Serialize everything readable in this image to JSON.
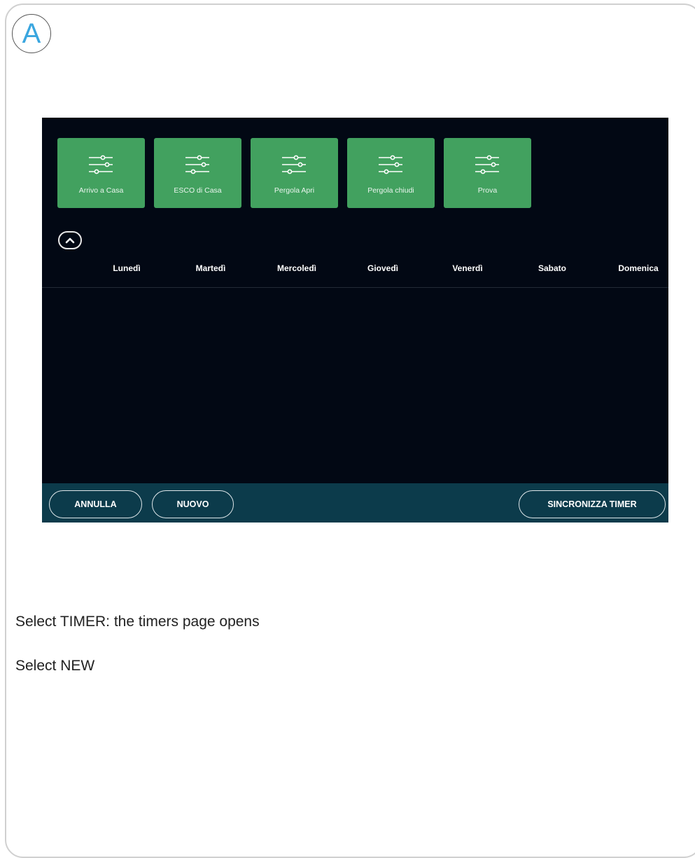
{
  "step": {
    "letter": "A"
  },
  "scenarios": [
    {
      "label": "Arrivo a Casa",
      "icon": "sliders-icon"
    },
    {
      "label": "ESCO di Casa",
      "icon": "sliders-icon"
    },
    {
      "label": "Pergola Apri",
      "icon": "sliders-icon"
    },
    {
      "label": "Pergola chiudi",
      "icon": "sliders-icon"
    },
    {
      "label": "Prova",
      "icon": "sliders-icon"
    }
  ],
  "collapse": {
    "icon": "chevron-up-icon"
  },
  "days": [
    "Lunedì",
    "Martedì",
    "Mercoledì",
    "Giovedì",
    "Venerdì",
    "Sabato",
    "Domenica"
  ],
  "buttons": {
    "cancel": "ANNULLA",
    "new": "NUOVO",
    "sync": "SINCRONIZZA TIMER"
  },
  "instructions": [
    "Select TIMER: the timers page opens",
    "Select NEW"
  ],
  "colors": {
    "tile": "#42a15f",
    "screen_bg": "#020814",
    "bottom_bar": "#0c3b4b",
    "step_letter": "#3aa6df"
  }
}
